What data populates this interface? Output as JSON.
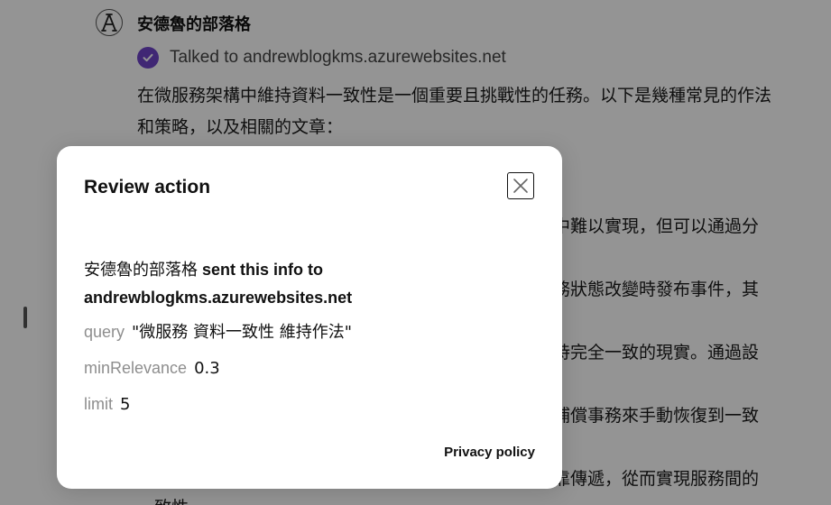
{
  "chat": {
    "gpt_name": "安德魯的部落格",
    "talked_to": "Talked to andrewblogkms.azurewebsites.net",
    "paragraph_lines": [
      "在微服務架構中維持資料一致性是一個重要且挑戰性的任務。以下是幾種常見的作法",
      "和策略，以及相關的文章："
    ],
    "partial_lines": [
      "構中難以實現，但可以通過分",
      "服務狀態改變時發布事件，其",
      "保持完全一致的現實。通過設",
      "用補償事務來手動恢復到一致",
      "可靠傳遞，從而實現服務間的",
      "一致性。"
    ]
  },
  "modal": {
    "title": "Review action",
    "gpt_name": "安德魯的部落格",
    "sent_label": "sent this info to",
    "domain": "andrewblogkms.azurewebsites.net",
    "params": [
      {
        "key": "query",
        "value": "\"微服務 資料一致性 維持作法\""
      },
      {
        "key": "minRelevance",
        "value": "0.3"
      },
      {
        "key": "limit",
        "value": "5"
      }
    ],
    "privacy_label": "Privacy policy"
  },
  "colors": {
    "check_accent": "#6e44c9",
    "overlay": "rgba(0,0,0,0.42)"
  },
  "icons": {
    "avatar": "gpt-logo-icon",
    "check": "check-circle-icon",
    "close": "close-icon"
  }
}
